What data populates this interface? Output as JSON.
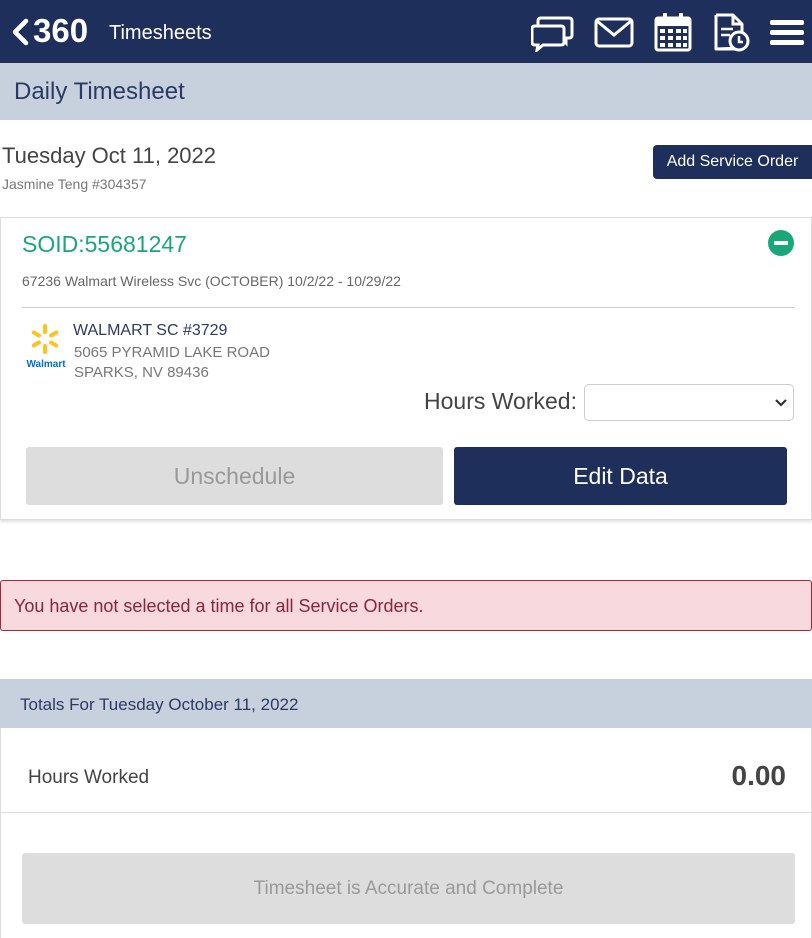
{
  "header": {
    "brand": "360",
    "title": "Timesheets",
    "icons": [
      "back-chevron-icon",
      "chat-icon",
      "mail-icon",
      "calendar-icon",
      "timesheet-clock-icon",
      "hamburger-menu-icon"
    ]
  },
  "subheader": {
    "title": "Daily Timesheet"
  },
  "day": {
    "date": "Tuesday Oct 11, 2022",
    "employee": "Jasmine Teng #304357",
    "add_button": "Add Service Order"
  },
  "service_order": {
    "soid": "SOID:55681247",
    "description": "67236 Walmart Wireless Svc (OCTOBER) 10/2/22 - 10/29/22",
    "store": {
      "logo_text": "Walmart",
      "name": "WALMART SC #3729",
      "address1": "5065 PYRAMID LAKE ROAD",
      "address2": "SPARKS, NV 89436"
    },
    "hours_label": "Hours Worked:",
    "hours_value": "",
    "unschedule_label": "Unschedule",
    "edit_label": "Edit Data"
  },
  "alert": {
    "text": "You have not selected a time for all Service Orders."
  },
  "totals": {
    "title": "Totals For Tuesday October 11, 2022",
    "hours_label": "Hours Worked",
    "hours_value": "0.00",
    "accurate_label": "Timesheet is Accurate and Complete"
  },
  "colors": {
    "navy": "#1f2f5b",
    "header_band": "#c7d1dd",
    "soid_green": "#1aa776",
    "walmart_blue": "#0071ce",
    "walmart_yellow": "#ffc220",
    "alert_bg": "#f8d9de",
    "alert_text": "#8a2638",
    "disabled_bg": "#dddddd"
  }
}
